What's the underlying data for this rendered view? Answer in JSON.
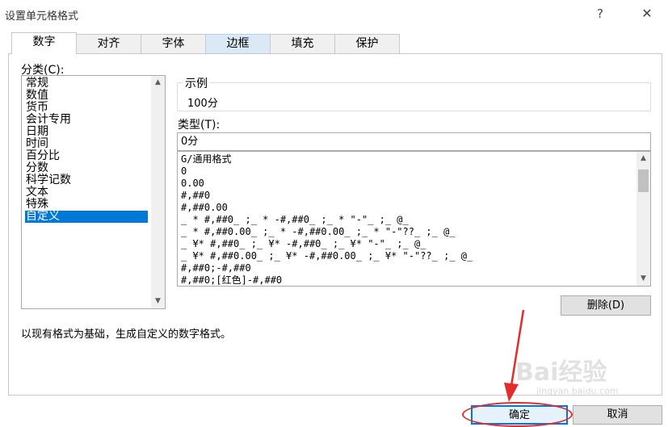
{
  "dialog": {
    "title": "设置单元格格式",
    "help_label": "?",
    "close_label": "✕"
  },
  "tabs": [
    {
      "label": "数字",
      "active": true
    },
    {
      "label": "对齐"
    },
    {
      "label": "字体"
    },
    {
      "label": "边框",
      "hover": true
    },
    {
      "label": "填充"
    },
    {
      "label": "保护"
    }
  ],
  "category": {
    "label": "分类(C):",
    "items": [
      "常规",
      "数值",
      "货币",
      "会计专用",
      "日期",
      "时间",
      "百分比",
      "分数",
      "科学记数",
      "文本",
      "特殊",
      "自定义"
    ],
    "selected": "自定义"
  },
  "sample": {
    "label": "示例",
    "value": "100分"
  },
  "type": {
    "label": "类型(T):",
    "value": "0分",
    "formats": [
      "G/通用格式",
      "0",
      "0.00",
      "#,##0",
      "#,##0.00",
      "_ * #,##0_ ;_ * -#,##0_ ;_ * \"-\"_ ;_ @_",
      "_ * #,##0.00_ ;_ * -#,##0.00_ ;_ * \"-\"??_ ;_ @_",
      "_ ¥* #,##0_ ;_ ¥* -#,##0_ ;_ ¥* \"-\"_ ;_ @_",
      "_ ¥* #,##0.00_ ;_ ¥* -#,##0.00_ ;_ ¥* \"-\"??_ ;_ @_",
      "#,##0;-#,##0",
      "#,##0;[红色]-#,##0"
    ]
  },
  "delete_label": "删除(D)",
  "description": "以现有格式为基础，生成自定义的数字格式。",
  "ok_label": "确定",
  "cancel_label": "取消",
  "watermark": {
    "text": "Bai经验",
    "sub": "jingyan.baidu.com"
  },
  "colors": {
    "selection": "#0078d7",
    "annotation": "#e52b2b"
  }
}
